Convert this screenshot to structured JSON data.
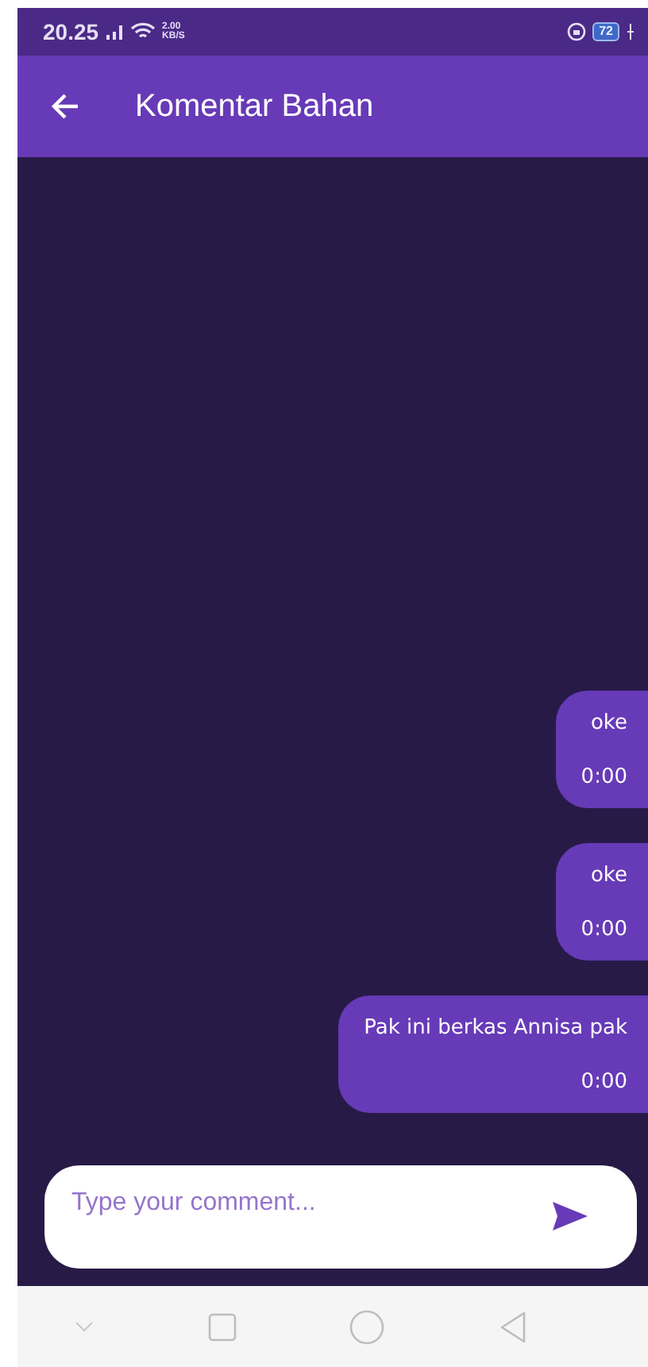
{
  "status_bar": {
    "time": "20.25",
    "speed_value": "2.00",
    "speed_unit": "KB/S",
    "battery": "72"
  },
  "app_bar": {
    "title": "Komentar Bahan"
  },
  "comments": [
    {
      "text": "oke",
      "time": "0:00"
    },
    {
      "text": "oke",
      "time": "0:00"
    },
    {
      "text": "Pak ini berkas Annisa pak",
      "time": "0:00"
    }
  ],
  "input": {
    "placeholder": "Type your comment..."
  }
}
